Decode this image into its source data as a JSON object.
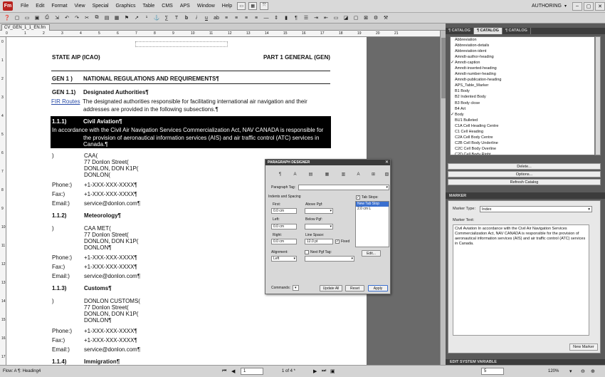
{
  "app": {
    "logo": "Fm",
    "workspace": "AUTHORING",
    "win_controls": [
      "–",
      "▢",
      "✕"
    ]
  },
  "menu": [
    "File",
    "Edit",
    "Format",
    "View",
    "Special",
    "Graphics",
    "Table",
    "CMS",
    "APS",
    "Window",
    "Help"
  ],
  "toolbar_icons": [
    "print-icon",
    "save-icon",
    "copy-icon",
    "paste-icon",
    "undo-icon",
    "redo-icon",
    "spell-icon"
  ],
  "doc_tab": "CV_GEN_1_1_EN.fm",
  "ruler": {
    "h": [
      "0",
      "1",
      "2",
      "3",
      "4",
      "5",
      "6",
      "7",
      "8",
      "9",
      "10",
      "11",
      "12",
      "13",
      "14",
      "15",
      "16",
      "17",
      "18",
      "19",
      "20",
      "21"
    ],
    "v": [
      "0",
      "1",
      "2",
      "3",
      "4",
      "5",
      "6",
      "7",
      "8",
      "9",
      "10",
      "11",
      "12",
      "13",
      "14",
      "15",
      "16",
      "17"
    ]
  },
  "page": {
    "header_left": "STATE AIP (ICAO)",
    "header_right": "PART 1 GENERAL (GEN)",
    "h1_num": "GEN 1 )",
    "h1_title": "NATIONAL REGULATIONS AND REQUIREMENTS¶",
    "h2_num": "GEN 1.1)",
    "h2_title": "Designated Authorities¶",
    "fir_link": "FIR Routes",
    "intro_line1": "The designated authorities responsible for facilitating international air navigation and their",
    "intro_line2": "addresses are provided in the following subsections.¶",
    "civil_num": "1.1.1)",
    "civil_title": "Civil Aviation¶",
    "civil_line1": "In accordance with the Civil Air Navigation Services Commercialization Act, NAV CANADA is responsible for",
    "civil_line2": "the provision of aeronautical information services (AIS) and air traffic control (ATC) services in",
    "civil_line3": "Canada.¶",
    "blocks": [
      {
        "marker": ")",
        "name": "CAA(",
        "street": "77 Donlon Street(",
        "city": "DONLON, DON K1P(",
        "country": "DONLON(",
        "phone_label": "Phone:)",
        "phone": "+1-XXX-XXX-XXXX¶",
        "fax_label": "Fax:)",
        "fax": "+1-XXX-XXX-XXXX¶",
        "email_label": "Email:)",
        "email": "service@donlon.com¶"
      },
      {
        "num": "1.1.2)",
        "title": "Meteorology¶",
        "marker": ")",
        "name": "CAA MET(",
        "street": "77 Donlon Street(",
        "city": "DONLON, DON K1P(",
        "country": "DONLON¶",
        "phone_label": "Phone:)",
        "phone": "+1-XXX-XXX-XXXX¶",
        "fax_label": "Fax:)",
        "fax": "+1-XXX-XXX-XXXX¶",
        "email_label": "Email:)",
        "email": "service@donlon.com¶"
      },
      {
        "num": "1.1.3)",
        "title": "Customs¶",
        "marker": ")",
        "name": "DONLON CUSTOMS(",
        "street": "77 Donlon Street(",
        "city": "DONLON, DON K1P(",
        "country": "DONLON¶",
        "phone_label": "Phone:)",
        "phone": "+1-XXX-XXX-XXXX¶",
        "fax_label": "Fax:)",
        "fax": "+1-XXX-XXX-XXXX¶",
        "email_label": "Email:)",
        "email": "service@donlon.com¶"
      }
    ],
    "last_num": "1.1.4)",
    "last_title": "Immigration¶"
  },
  "catalog": {
    "tabs": [
      "¶ CATALOG",
      "¶ CATALOG",
      "¶ CATALOG"
    ],
    "items": [
      "Abbreviation",
      "Abbreviation-details",
      "Abbreviation-ident",
      "Amndt-author-heading",
      "Amndt-caption",
      "Amndt-inserted-heading",
      "Amndt-number-heading",
      "Amndt-publication-heading",
      "APS_Table_Marker",
      "B1 Body",
      "B2 Indented Body",
      "B3 Body close",
      "B4 Art",
      "Body",
      "BU1 Bulleted",
      "C1A Cell Heading Centre",
      "C1 Cell Heading",
      "C2A Cell Body Centre",
      "C2B Cell Body Underline",
      "C2C Cell Body Overline",
      "C2D Cell Body Right"
    ],
    "checked": [
      4,
      13
    ],
    "buttons": [
      "Delete...",
      "Options...",
      "Refresh Catalog"
    ]
  },
  "marker": {
    "panel_title": "MARKER",
    "type_label": "Marker Type:",
    "type_value": "Index",
    "text_label": "Marker Text:",
    "text": "Civil Aviation In accordance with the Civil Air Navigation Services Commercialization Act, NAV CANADA is responsible for the provision of aeronautical information services (AIS) and air traffic control (ATC) services in Canada.",
    "new_button": "New Marker"
  },
  "sysvar": "EDIT SYSTEM VARIABLE",
  "status": {
    "flow": "Flow: A  ¶: Heading4",
    "page_input": "1",
    "page_of": "1 of 4 *",
    "zoom": "120%",
    "right_field": "5"
  },
  "dialog": {
    "title": "PARAGRAPH DESIGNER",
    "close": "✕",
    "tabs": [
      "¶",
      "A",
      "▤",
      "▦",
      "▥",
      "A",
      "⊞",
      "▧"
    ],
    "para_tag_label": "Paragraph Tag:",
    "indents_label": "Indents and Spacing",
    "first_label": "First:",
    "first_value": "0.0 cm",
    "left_label": "Left:",
    "left_value": "0.0 cm",
    "right_label": "Right:",
    "right_value": "0.0 cm",
    "above_label": "Above Pgf:",
    "below_label": "Below Pgf:",
    "linespace_label": "Line Space:",
    "linespace_value": "12.0 pt",
    "fixed_label": "Fixed",
    "tabstops_label": "Tab Stops:",
    "tabstop_new": "New Tab Stop",
    "tabstop_1": "2.0 cm  L",
    "alignment_label": "Alignment:",
    "alignment_value": "Left",
    "nextpgf_label": "Next Pgf Tag:",
    "edit_button": "Edit...",
    "commands_label": "Commands:",
    "updateall_button": "Update All",
    "reset_button": "Reset",
    "apply_button": "Apply"
  }
}
